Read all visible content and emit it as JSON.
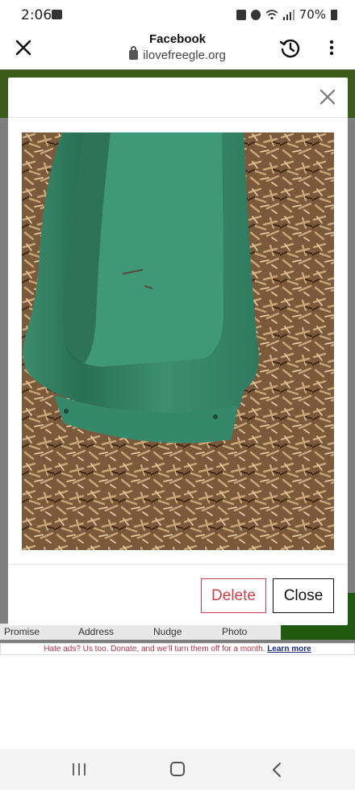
{
  "status_bar": {
    "time": "2:06",
    "battery": "70%"
  },
  "browser": {
    "title": "Facebook",
    "url": "ilovefreegle.org"
  },
  "modal": {
    "image_alt": "Green plastic slide on wood chips",
    "delete_label": "Delete",
    "close_label": "Close"
  },
  "background_page": {
    "tabs": [
      "Promise",
      "Address",
      "Nudge",
      "Photo"
    ],
    "ad_text": "Hate ads? Us too. Donate, and we'll turn them off for a month.",
    "ad_link": "Learn more"
  },
  "colors": {
    "delete_red": "#c9414f",
    "overlay_gray": "#7f7f7f",
    "brand_green": "#3c5a1a"
  },
  "icons": {
    "close": "close-icon",
    "history": "history-icon",
    "more": "more-vertical-icon",
    "lock": "lock-icon"
  }
}
